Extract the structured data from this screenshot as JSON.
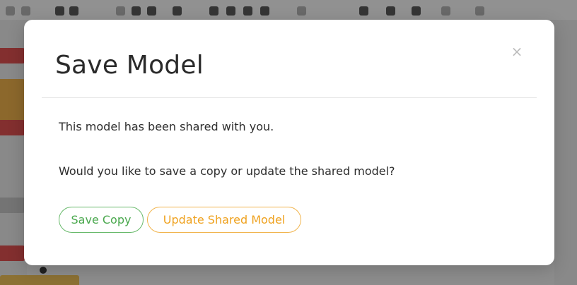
{
  "dialog": {
    "title": "Save Model",
    "close_symbol": "×",
    "message_line1": "This model has been shared with you.",
    "message_line2": "Would you like to save a copy or update the shared model?",
    "save_copy_label": "Save Copy",
    "update_label": "Update Shared Model"
  },
  "colors": {
    "save_copy": "#4aa84e",
    "update": "#efa21f",
    "overlay": "rgba(0,0,0,0.42)"
  }
}
